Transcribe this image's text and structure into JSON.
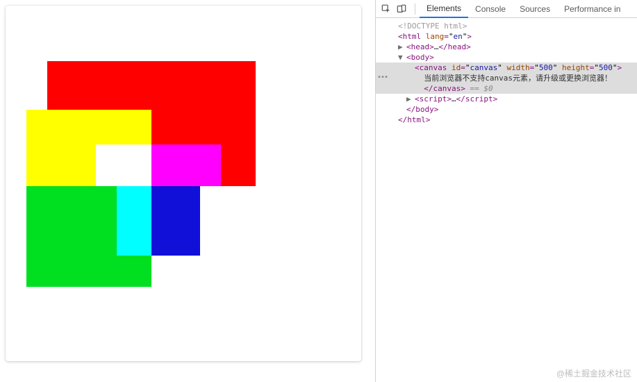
{
  "devtools": {
    "tabs": {
      "elements": "Elements",
      "console": "Console",
      "sources": "Sources",
      "performance": "Performance in"
    },
    "dom": {
      "doctype": "<!DOCTYPE html>",
      "html_open": "<",
      "html_tag": "html",
      "html_attr_lang_name": "lang",
      "html_attr_lang_val": "en",
      "head_open_tag": "head",
      "head_ellipsis": "…",
      "head_close_tag": "head",
      "body_tag": "body",
      "canvas_tag": "canvas",
      "canvas_id_attr": "id",
      "canvas_id_val": "canvas",
      "canvas_w_attr": "width",
      "canvas_w_val": "500",
      "canvas_h_attr": "height",
      "canvas_h_val": "500",
      "canvas_text_fallback": "当前浏览器不支持canvas元素，请升级或更换浏览器！",
      "canvas_close_tag": "canvas",
      "selected_marker": " == $0",
      "script_tag": "script",
      "script_ellipsis": "…",
      "body_close_tag": "body",
      "html_close_tag": "html"
    }
  },
  "canvas": {
    "width": "500",
    "height": "500",
    "rects": [
      {
        "color": "#ff0000",
        "name": "red"
      },
      {
        "color": "#ffff00",
        "name": "yellow"
      },
      {
        "color": "#ffffff",
        "name": "white"
      },
      {
        "color": "#ff00ff",
        "name": "magenta"
      },
      {
        "color": "#00e020",
        "name": "green"
      },
      {
        "color": "#00ffff",
        "name": "cyan"
      },
      {
        "color": "#1010d8",
        "name": "blue"
      }
    ]
  },
  "watermark": "@稀土掘金技术社区"
}
